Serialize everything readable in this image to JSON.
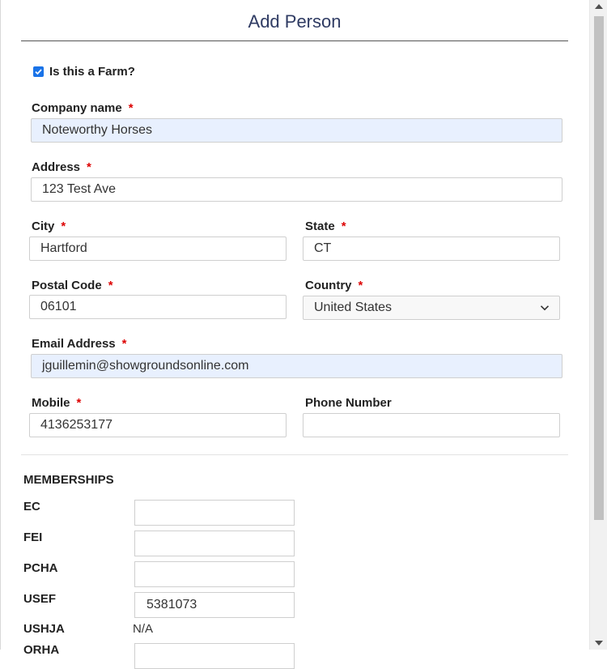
{
  "dialog": {
    "title": "Add Person"
  },
  "farm_checkbox": {
    "label": "Is this a Farm?",
    "checked": true
  },
  "required_mark": "*",
  "fields": {
    "company_name": {
      "label": "Company name",
      "value": "Noteworthy Horses"
    },
    "address": {
      "label": "Address",
      "value": "123 Test Ave"
    },
    "city": {
      "label": "City",
      "value": "Hartford"
    },
    "state": {
      "label": "State",
      "value": "CT"
    },
    "postal_code": {
      "label": "Postal Code",
      "value": "06101"
    },
    "country": {
      "label": "Country",
      "value": "United States"
    },
    "email": {
      "label": "Email Address",
      "value": "jguillemin@showgroundsonline.com"
    },
    "mobile": {
      "label": "Mobile",
      "value": "4136253177"
    },
    "phone": {
      "label": "Phone Number",
      "value": ""
    }
  },
  "memberships": {
    "title": "MEMBERSHIPS",
    "items": [
      {
        "label": "EC",
        "value": ""
      },
      {
        "label": "FEI",
        "value": ""
      },
      {
        "label": "PCHA",
        "value": ""
      },
      {
        "label": "USEF",
        "value": "5381073"
      },
      {
        "label": "USHJA",
        "value": "N/A"
      },
      {
        "label": "ORHA",
        "value": ""
      }
    ]
  },
  "icons": {
    "checkbox": "check-icon",
    "dropdown": "chevron-down-icon"
  },
  "colors": {
    "title": "#2f3b63",
    "required": "#dd0000",
    "autofill": "#e8f0fe",
    "checkbox": "#1a73e8"
  }
}
